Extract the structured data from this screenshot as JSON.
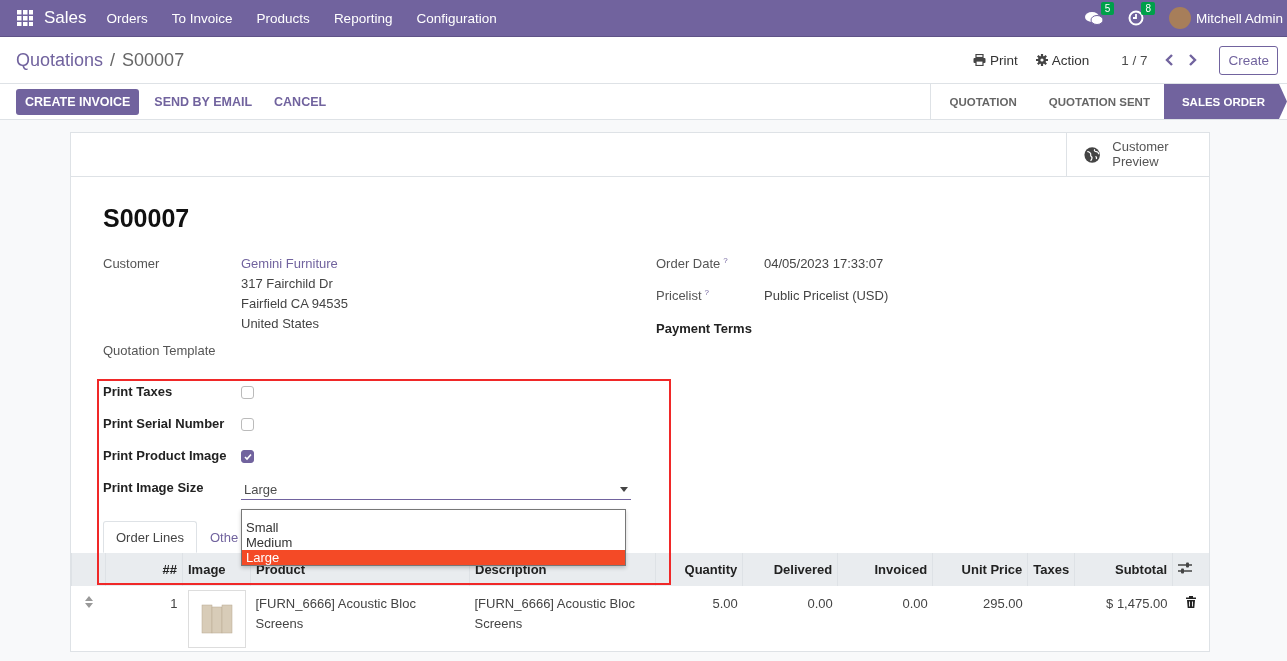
{
  "navbar": {
    "app": "Sales",
    "menu": [
      "Orders",
      "To Invoice",
      "Products",
      "Reporting",
      "Configuration"
    ],
    "messages_badge": "5",
    "activities_badge": "8",
    "user": "Mitchell Admin"
  },
  "breadcrumb": {
    "parent": "Quotations",
    "separator": "/",
    "current": "S00007"
  },
  "toolbar": {
    "print": "Print",
    "action": "Action",
    "pager": "1 / 7",
    "create": "Create"
  },
  "action_buttons": [
    {
      "label": "CREATE INVOICE",
      "primary": true
    },
    {
      "label": "SEND BY EMAIL",
      "primary": false
    },
    {
      "label": "CANCEL",
      "primary": false
    }
  ],
  "statusbar": [
    {
      "label": "QUOTATION",
      "selected": false
    },
    {
      "label": "QUOTATION SENT",
      "selected": false
    },
    {
      "label": "SALES ORDER",
      "selected": true
    }
  ],
  "smart_button": {
    "label": "Customer Preview"
  },
  "record_name": "S00007",
  "customer": {
    "label": "Customer",
    "name": "Gemini Furniture",
    "address": [
      "317 Fairchild Dr",
      "Fairfield CA 94535",
      "United States"
    ]
  },
  "quotation_template": {
    "label": "Quotation Template"
  },
  "right_fields": [
    {
      "label": "Order Date",
      "help": "?",
      "value": "04/05/2023 17:33:07",
      "required": false
    },
    {
      "label": "Pricelist",
      "help": "?",
      "value": "Public Pricelist (USD)",
      "required": false
    },
    {
      "label": "Payment Terms",
      "required": true
    }
  ],
  "print_options": [
    {
      "label": "Print Taxes",
      "kind": "checkbox",
      "checked": false
    },
    {
      "label": "Print Serial Number",
      "kind": "checkbox",
      "checked": false
    },
    {
      "label": "Print Product Image",
      "kind": "checkbox",
      "checked": true
    },
    {
      "label": "Print Image Size",
      "kind": "select",
      "value": "Large"
    }
  ],
  "dropdown_options": [
    {
      "label": "Small",
      "selected": false
    },
    {
      "label": "Medium",
      "selected": false
    },
    {
      "label": "Large",
      "selected": true
    }
  ],
  "tabs": [
    {
      "label": "Order Lines",
      "selected": true
    },
    {
      "label": "Othe",
      "selected": false
    }
  ],
  "table": {
    "columns": [
      "##",
      "Image",
      "Product",
      "Description",
      "Quantity",
      "Delivered",
      "Invoiced",
      "Unit Price",
      "Taxes",
      "Subtotal"
    ],
    "rows": [
      {
        "number": "1",
        "product": "[FURN_6666] Acoustic Bloc Screens",
        "description": "[FURN_6666] Acoustic Bloc Screens",
        "quantity": "5.00",
        "delivered": "0.00",
        "invoiced": "0.00",
        "unit_price": "295.00",
        "subtotal": "$ 1,475.00"
      }
    ]
  }
}
